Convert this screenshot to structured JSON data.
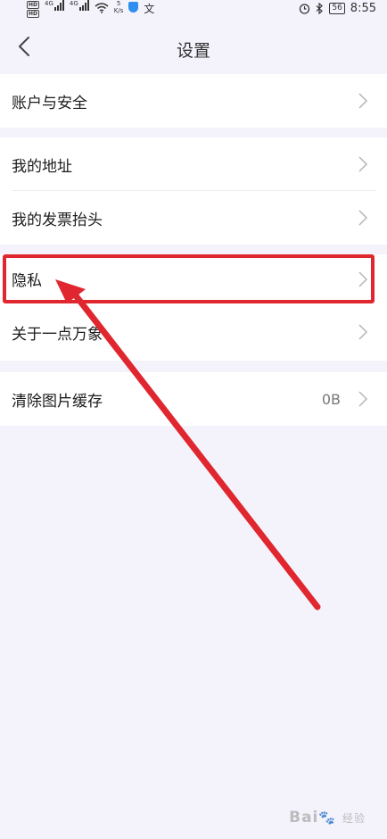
{
  "status_bar": {
    "hd1": "HD",
    "hd2": "HD",
    "sig1": "4G",
    "sig2": "4G",
    "speed_num": "5",
    "speed_unit": "K/s",
    "icon_extra": "文",
    "battery": "56",
    "time": "8:55"
  },
  "header": {
    "title": "设置"
  },
  "groups": [
    {
      "items": [
        {
          "label": "账户与安全"
        }
      ]
    },
    {
      "items": [
        {
          "label": "我的地址"
        },
        {
          "label": "我的发票抬头"
        }
      ]
    },
    {
      "items": [
        {
          "label": "隐私"
        },
        {
          "label": "关于一点万象"
        }
      ]
    },
    {
      "items": [
        {
          "label": "清除图片缓存",
          "value": "0B"
        }
      ]
    }
  ],
  "annotation": {
    "color": "#e0262f"
  },
  "watermark": {
    "text": "Bai",
    "sub": "经验"
  }
}
